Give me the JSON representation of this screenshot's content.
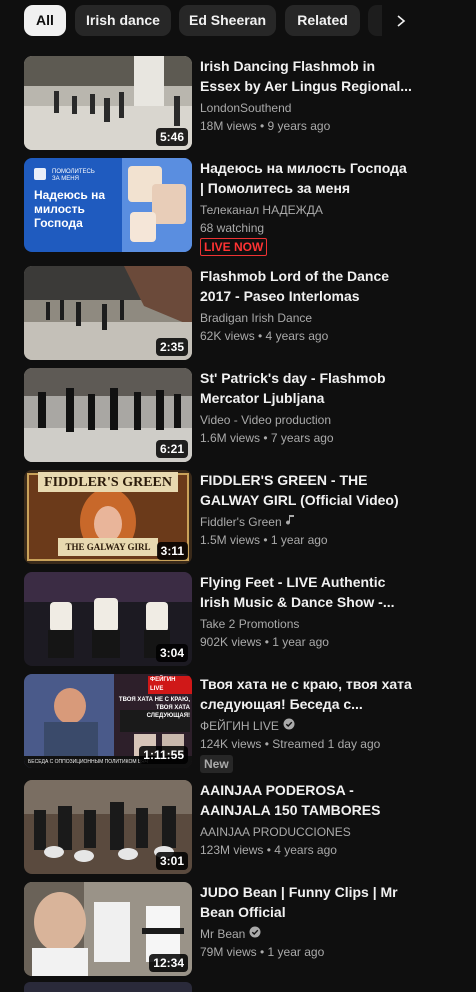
{
  "chips": [
    {
      "label": "All",
      "active": true
    },
    {
      "label": "Irish dance",
      "active": false
    },
    {
      "label": "Ed Sheeran",
      "active": false
    },
    {
      "label": "Related",
      "active": false
    }
  ],
  "videos": [
    {
      "title": "Irish Dancing Flashmob in Essex by Aer Lingus Regional...",
      "channel": "LondonSouthend",
      "meta": "18M views • 9 years ago",
      "duration": "5:46"
    },
    {
      "title": "Надеюсь на милость Господа | Помолитесь за меня",
      "channel": "Телеканал НАДЕЖДА",
      "meta": "68 watching",
      "badge": "LIVE NOW",
      "thumb_text_small": "ПОМОЛИТЕСЬ ЗА МЕНЯ",
      "thumb_text_big": "Надеюсь на милость Господа"
    },
    {
      "title": "Flashmob Lord of the Dance 2017 - Paseo Interlomas",
      "channel": "Bradigan Irish Dance",
      "meta": "62K views • 4 years ago",
      "duration": "2:35"
    },
    {
      "title": "St' Patrick's day - Flashmob Mercator Ljubljana",
      "channel": "Video - Video production",
      "meta": "1.6M views • 7 years ago",
      "duration": "6:21"
    },
    {
      "title": "FIDDLER'S GREEN - THE GALWAY GIRL (Official Video)",
      "channel": "Fiddler's Green",
      "meta": "1.5M views • 1 year ago",
      "duration": "3:11",
      "thumb_top": "FIDDLER'S GREEN",
      "thumb_bottom": "THE GALWAY GIRL"
    },
    {
      "title": "Flying Feet - LIVE Authentic Irish Music & Dance Show -...",
      "channel": "Take 2 Promotions",
      "meta": "902K views • 1 year ago",
      "duration": "3:04"
    },
    {
      "title": "Твоя хата не с краю, твоя хата следующая! Беседа с...",
      "channel": "ФЕЙГИН LIVE",
      "meta": "124K views • Streamed 1 day ago",
      "duration": "1:11:55",
      "badge": "New",
      "thumb_tag": "ФЕЙГИН LIVE",
      "thumb_line1": "ТВОЯ ХАТА НЕ С КРАЮ,",
      "thumb_line2": "ТВОЯ ХАТА СЛЕДУЮЩАЯ!",
      "thumb_bottom": "БЕСЕДА С ОППОЗИЦИОННЫМ ПОЛИТИКОМ ВЯЧЕС"
    },
    {
      "title": "AAINJAA PODEROSA - AAINJALA 150 TAMBORES",
      "channel": "AAINJAA PRODUCCIONES",
      "meta": "123M views • 4 years ago",
      "duration": "3:01"
    },
    {
      "title": "JUDO Bean | Funny Clips | Mr Bean Official",
      "channel": "Mr Bean",
      "meta": "79M views • 1 year ago",
      "duration": "12:34"
    }
  ],
  "colors": {
    "background": "#0f0f0f",
    "chip": "#272727",
    "live": "#ff3333",
    "text_secondary": "#aaaaaa"
  }
}
